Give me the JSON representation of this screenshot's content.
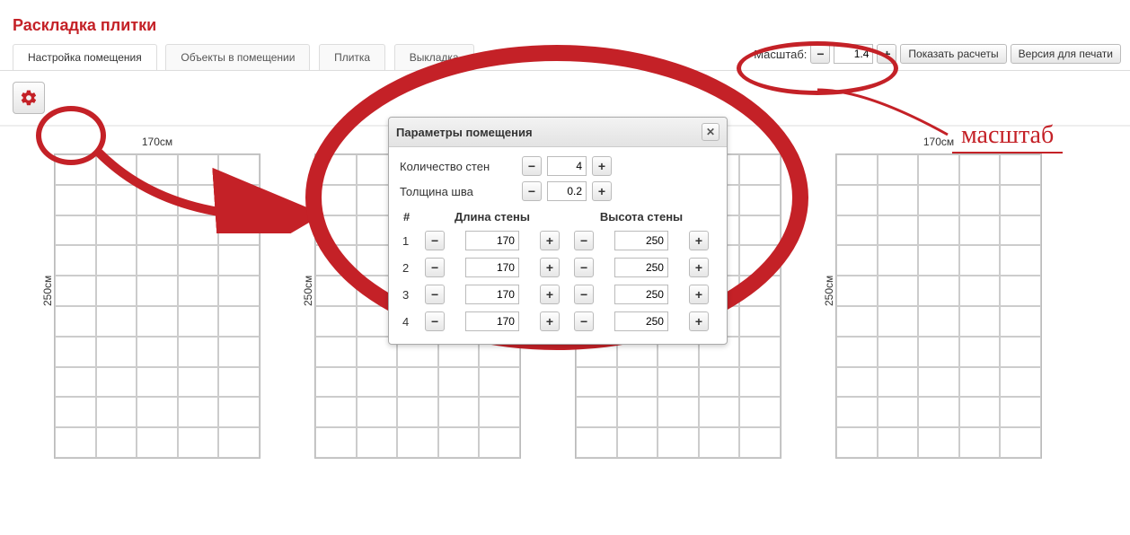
{
  "title": "Раскладка плитки",
  "tabs": [
    "Настройка помещения",
    "Объекты в помещении",
    "Плитка",
    "Выкладка"
  ],
  "activeTab": 0,
  "scale": {
    "label": "Масштаб:",
    "value": "1.4"
  },
  "buttons": {
    "showCalc": "Показать расчеты",
    "printVersion": "Версия для печати"
  },
  "dialog": {
    "title": "Параметры помещения",
    "wallCountLabel": "Количество стен",
    "wallCount": "4",
    "seamLabel": "Толщина шва",
    "seam": "0.2",
    "col_idx": "#",
    "col_len": "Длина стены",
    "col_h": "Высота стены",
    "rows": [
      {
        "n": "1",
        "len": "170",
        "h": "250"
      },
      {
        "n": "2",
        "len": "170",
        "h": "250"
      },
      {
        "n": "3",
        "len": "170",
        "h": "250"
      },
      {
        "n": "4",
        "len": "170",
        "h": "250"
      }
    ]
  },
  "wall": {
    "w": "170см",
    "h": "250см"
  },
  "anno": {
    "scaleWord": "масштаб"
  }
}
